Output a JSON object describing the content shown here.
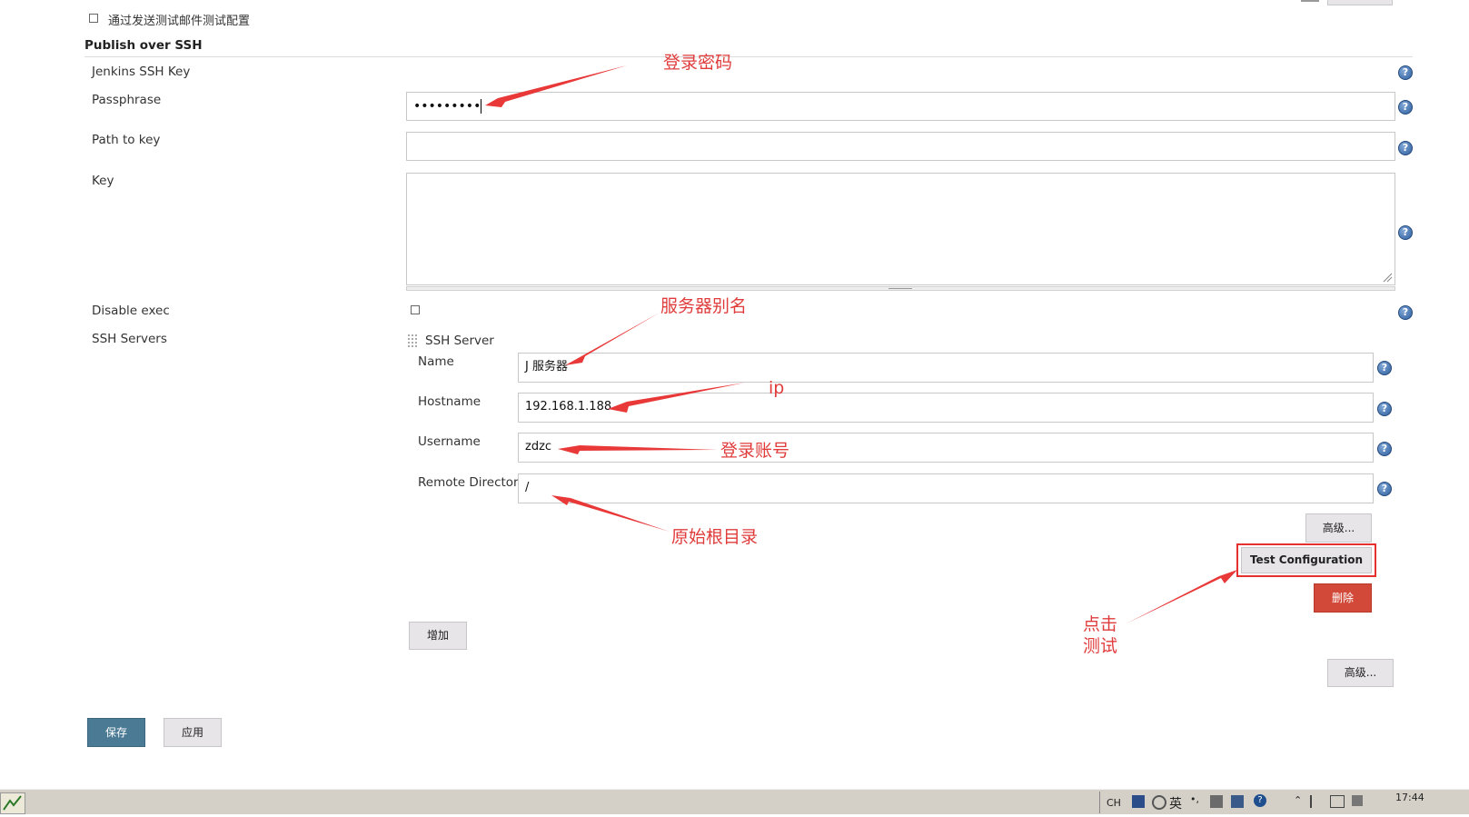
{
  "top_option": {
    "label": "通过发送测试邮件测试配置"
  },
  "section": {
    "title": "Publish over SSH"
  },
  "fields": {
    "jenkins_ssh_key": "Jenkins SSH Key",
    "passphrase": "Passphrase",
    "passphrase_value": "•••••••••",
    "path_to_key": "Path to key",
    "key": "Key",
    "disable_exec": "Disable exec",
    "ssh_servers": "SSH Servers"
  },
  "ssh_server": {
    "header": "SSH Server",
    "name_label": "Name",
    "name_value": "J 服务器",
    "hostname_label": "Hostname",
    "hostname_value": "192.168.1.188",
    "username_label": "Username",
    "username_value": "zdzc",
    "remote_dir_label": "Remote Directory",
    "remote_dir_value": "/"
  },
  "buttons": {
    "advanced_inner": "高级...",
    "test_configuration": "Test Configuration",
    "delete": "删除",
    "add": "增加",
    "advanced_outer": "高级...",
    "save": "保存",
    "apply": "应用"
  },
  "annotations": {
    "login_password": "登录密码",
    "server_alias": "服务器别名",
    "ip": "ip",
    "login_account": "登录账号",
    "root_dir": "原始根目录",
    "click_test_1": "点击",
    "click_test_2": "测试"
  },
  "taskbar": {
    "lang": "CH",
    "ime": "英",
    "time": "17:44"
  },
  "colors": {
    "save_button": "#4b7a95",
    "delete_button": "#d24939",
    "annotation": "#e03c3c",
    "help_icon": "#2f5f9e"
  }
}
